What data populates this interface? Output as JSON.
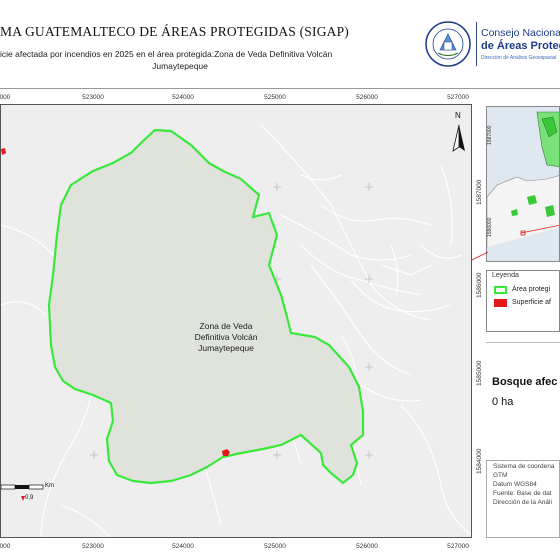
{
  "header": {
    "title": "MA GUATEMALTECO DE ÁREAS PROTEGIDAS  (SIGAP)",
    "subtitle_line1": "icie afectada por incendios en 2025 en el área protegida:Zona de Veda Definitiva Volcán",
    "subtitle_line2": "Jumaytepeque",
    "conap_line1": "Consejo Nacional",
    "conap_line2": "de Áreas Protegi",
    "conap_line3": "Dirección de Análisis Geoespacial",
    "seal_text_top": "GOBIERNO DE LA REPÚBLICA",
    "seal_text_bottom": "GUATEMALA"
  },
  "map": {
    "area_label_lines": [
      "Zona de Veda",
      "Definitiva Volcán",
      "Jumaytepeque"
    ],
    "north_label": "N",
    "x_ticks": [
      "000",
      "523000",
      "524000",
      "525000",
      "526000",
      "527000"
    ],
    "y_ticks": [
      "1587000",
      "1586000",
      "1585000",
      "1584000"
    ],
    "scale_unit": "Km",
    "scale_value": "0,9",
    "fire_affected": true,
    "colors": {
      "map_background": "#eeeeee",
      "area_fill": "#dfe3dc",
      "area_outline": "#39e83a",
      "fire": "#e31a1c",
      "roads": "#ffffff"
    }
  },
  "legend": {
    "title": "Leyenda",
    "items": [
      {
        "label": "Área protegi",
        "swatch": "outline",
        "color": "#39e83a"
      },
      {
        "label": "Superficie af",
        "swatch": "fill",
        "color": "#e31a1c"
      }
    ]
  },
  "stats": {
    "title": "Bosque afec",
    "value": "0 ha"
  },
  "metadata": [
    "Sistema de coordena",
    "GTM",
    "Datum WGS84",
    "Fuente: Base de dat",
    "Dirección de la Análi"
  ]
}
